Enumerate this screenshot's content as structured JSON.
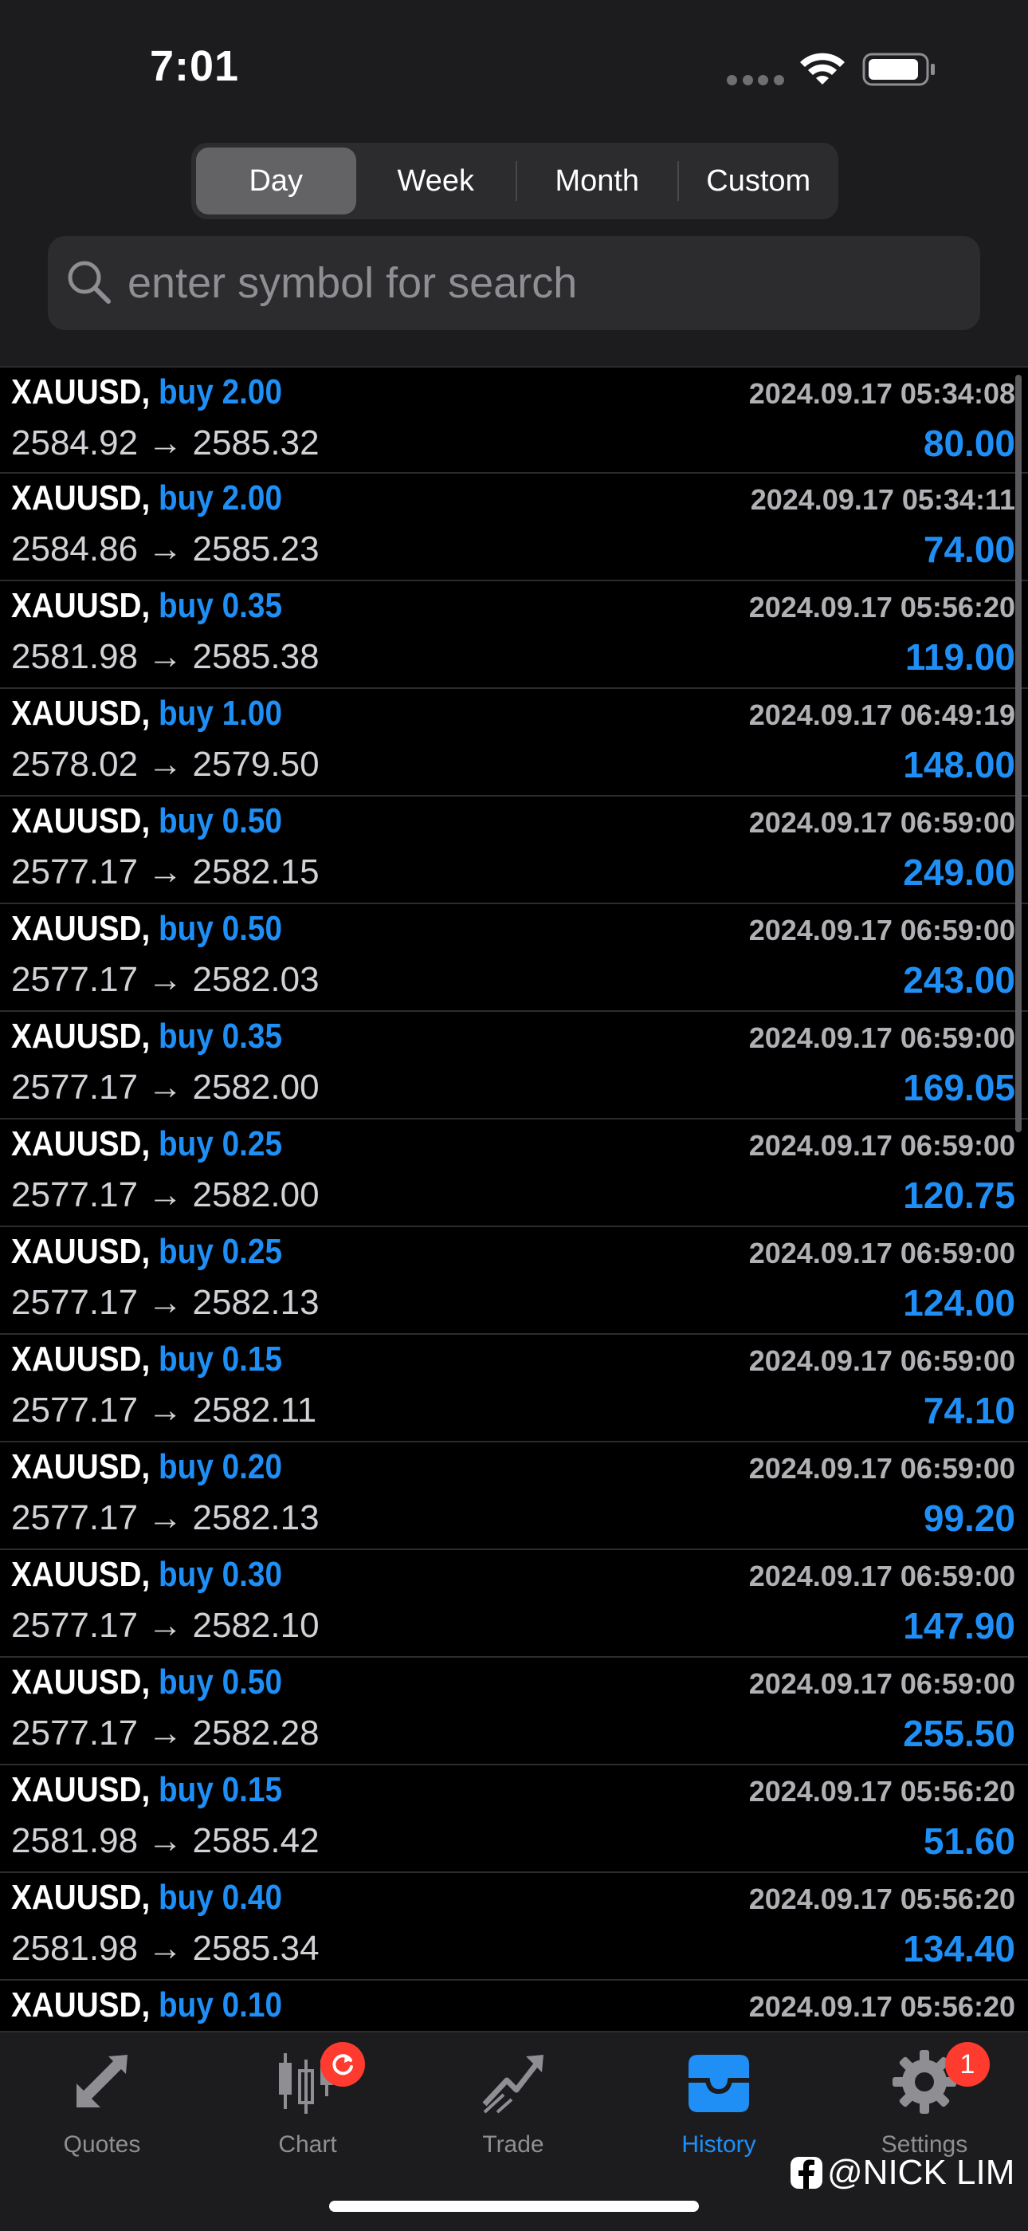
{
  "status_bar": {
    "time": "7:01"
  },
  "period_tabs": [
    {
      "label": "Day",
      "active": true
    },
    {
      "label": "Week",
      "active": false
    },
    {
      "label": "Month",
      "active": false
    },
    {
      "label": "Custom",
      "active": false
    }
  ],
  "search": {
    "placeholder": "enter symbol for search"
  },
  "deals": [
    {
      "symbol": "XAUUSD,",
      "type": "buy 2.00",
      "time": "2024.09.17 05:34:08",
      "prices": "2584.92 → 2585.32",
      "profit": "80.00"
    },
    {
      "symbol": "XAUUSD,",
      "type": "buy 2.00",
      "time": "2024.09.17 05:34:11",
      "prices": "2584.86 → 2585.23",
      "profit": "74.00"
    },
    {
      "symbol": "XAUUSD,",
      "type": "buy 0.35",
      "time": "2024.09.17 05:56:20",
      "prices": "2581.98 → 2585.38",
      "profit": "119.00"
    },
    {
      "symbol": "XAUUSD,",
      "type": "buy 1.00",
      "time": "2024.09.17 06:49:19",
      "prices": "2578.02 → 2579.50",
      "profit": "148.00"
    },
    {
      "symbol": "XAUUSD,",
      "type": "buy 0.50",
      "time": "2024.09.17 06:59:00",
      "prices": "2577.17 → 2582.15",
      "profit": "249.00"
    },
    {
      "symbol": "XAUUSD,",
      "type": "buy 0.50",
      "time": "2024.09.17 06:59:00",
      "prices": "2577.17 → 2582.03",
      "profit": "243.00"
    },
    {
      "symbol": "XAUUSD,",
      "type": "buy 0.35",
      "time": "2024.09.17 06:59:00",
      "prices": "2577.17 → 2582.00",
      "profit": "169.05"
    },
    {
      "symbol": "XAUUSD,",
      "type": "buy 0.25",
      "time": "2024.09.17 06:59:00",
      "prices": "2577.17 → 2582.00",
      "profit": "120.75"
    },
    {
      "symbol": "XAUUSD,",
      "type": "buy 0.25",
      "time": "2024.09.17 06:59:00",
      "prices": "2577.17 → 2582.13",
      "profit": "124.00"
    },
    {
      "symbol": "XAUUSD,",
      "type": "buy 0.15",
      "time": "2024.09.17 06:59:00",
      "prices": "2577.17 → 2582.11",
      "profit": "74.10"
    },
    {
      "symbol": "XAUUSD,",
      "type": "buy 0.20",
      "time": "2024.09.17 06:59:00",
      "prices": "2577.17 → 2582.13",
      "profit": "99.20"
    },
    {
      "symbol": "XAUUSD,",
      "type": "buy 0.30",
      "time": "2024.09.17 06:59:00",
      "prices": "2577.17 → 2582.10",
      "profit": "147.90"
    },
    {
      "symbol": "XAUUSD,",
      "type": "buy 0.50",
      "time": "2024.09.17 06:59:00",
      "prices": "2577.17 → 2582.28",
      "profit": "255.50"
    },
    {
      "symbol": "XAUUSD,",
      "type": "buy 0.15",
      "time": "2024.09.17 05:56:20",
      "prices": "2581.98 → 2585.42",
      "profit": "51.60"
    },
    {
      "symbol": "XAUUSD,",
      "type": "buy 0.40",
      "time": "2024.09.17 05:56:20",
      "prices": "2581.98 → 2585.34",
      "profit": "134.40"
    },
    {
      "symbol": "XAUUSD,",
      "type": "buy 0.10",
      "time": "2024.09.17 05:56:20",
      "prices": "",
      "profit": ""
    }
  ],
  "tabbar": {
    "quotes": "Quotes",
    "chart": "Chart",
    "trade": "Trade",
    "history": "History",
    "settings": "Settings",
    "settings_badge": "1"
  },
  "watermark": "@NICK LIM",
  "colors": {
    "accent_blue": "#1f8ff5",
    "badge_red": "#ff3b30",
    "background": "#000000",
    "header_bg": "#1c1c1e"
  },
  "icons": {
    "quotes": "arrows-diagonal-icon",
    "chart": "candlestick-icon",
    "trade": "trend-line-icon",
    "history": "inbox-tray-icon",
    "settings": "gear-icon"
  }
}
